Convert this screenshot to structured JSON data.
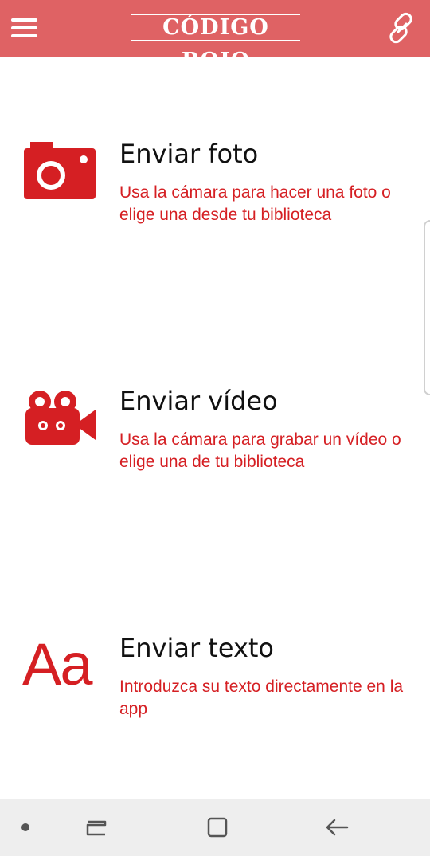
{
  "appbar": {
    "title": "CÓDIGO ROJO",
    "menu_icon": "hamburger-menu-icon",
    "link_icon": "link-chain-icon",
    "background_color": "#df6264"
  },
  "options": [
    {
      "icon": "camera-icon",
      "title": "Enviar foto",
      "description": "Usa la cámara para hacer una foto o elige una desde tu biblioteca"
    },
    {
      "icon": "video-camera-icon",
      "title": "Enviar vídeo",
      "description": "Usa la cámara para grabar un vídeo o elige una de tu biblioteca"
    },
    {
      "icon": "text-icon",
      "icon_text": "Aa",
      "title": "Enviar texto",
      "description": "Introduzca su texto directamente en la app"
    }
  ],
  "accent_color": "#d51f23",
  "system_nav": {
    "items": [
      "dot-icon",
      "recents-icon",
      "home-icon",
      "back-icon"
    ]
  }
}
